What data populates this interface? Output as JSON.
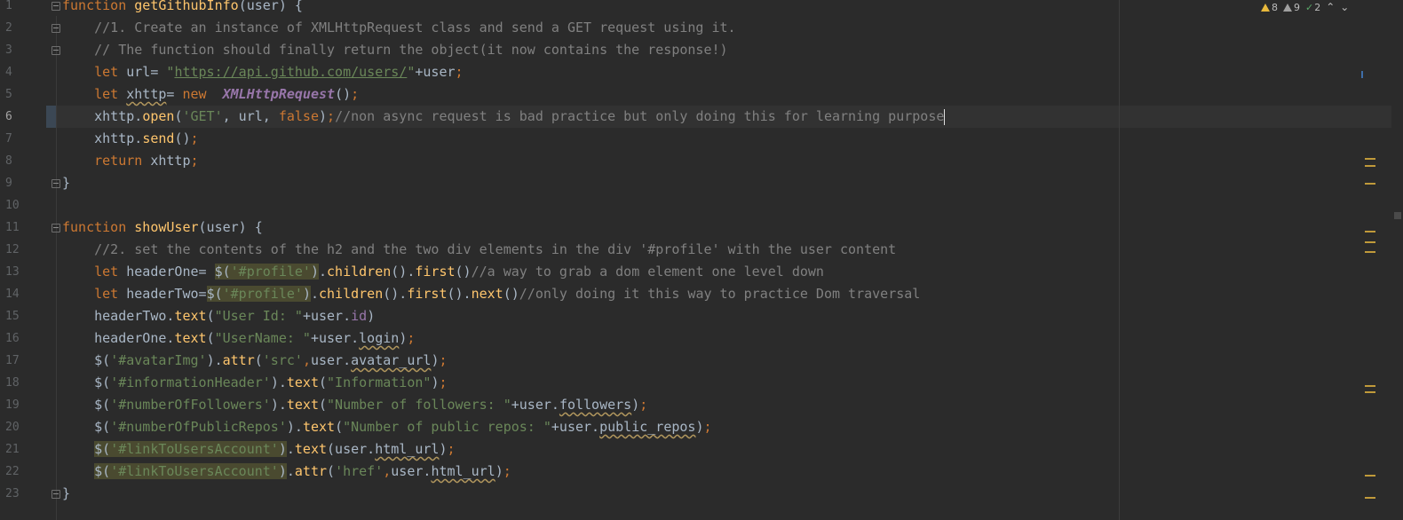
{
  "inspections": {
    "warnings": "8",
    "weak_warnings": "9",
    "typos": "2",
    "up": "⌃",
    "down": "⌄"
  },
  "current_line": "6",
  "lines": [
    {
      "n": "1",
      "text": "function getGithubInfo(user) {"
    },
    {
      "n": "2",
      "text": "    //1. Create an instance of XMLHttpRequest class and send a GET request using it."
    },
    {
      "n": "3",
      "text": "    // The function should finally return the object(it now contains the response!)"
    },
    {
      "n": "4",
      "text": "    let url= \"https://api.github.com/users/\"+user;"
    },
    {
      "n": "5",
      "text": "    let xhttp= new  XMLHttpRequest();"
    },
    {
      "n": "6",
      "text": "    xhttp.open('GET', url, false);//non async request is bad practice but only doing this for learning purpose"
    },
    {
      "n": "7",
      "text": "    xhttp.send();"
    },
    {
      "n": "8",
      "text": "    return xhttp;"
    },
    {
      "n": "9",
      "text": "}"
    },
    {
      "n": "10",
      "text": ""
    },
    {
      "n": "11",
      "text": "function showUser(user) {"
    },
    {
      "n": "12",
      "text": "    //2. set the contents of the h2 and the two div elements in the div '#profile' with the user content"
    },
    {
      "n": "13",
      "text": "    let headerOne= $('#profile').children().first()//a way to grab a dom element one level down"
    },
    {
      "n": "14",
      "text": "    let headerTwo=$('#profile').children().first().next()//only doing it this way to practice Dom traversal"
    },
    {
      "n": "15",
      "text": "    headerTwo.text(\"User Id: \"+user.id)"
    },
    {
      "n": "16",
      "text": "    headerOne.text(\"UserName: \"+user.login);"
    },
    {
      "n": "17",
      "text": "    $('#avatarImg').attr('src',user.avatar_url);"
    },
    {
      "n": "18",
      "text": "    $('#informationHeader').text(\"Information\");"
    },
    {
      "n": "19",
      "text": "    $('#numberOfFollowers').text(\"Number of followers: \"+user.followers);"
    },
    {
      "n": "20",
      "text": "    $('#numberOfPublicRepos').text(\"Number of public repos: \"+user.public_repos);"
    },
    {
      "n": "21",
      "text": "    $('#linkToUsersAccount').text(user.html_url);"
    },
    {
      "n": "22",
      "text": "    $('#linkToUsersAccount').attr('href',user.html_url);"
    },
    {
      "n": "23",
      "text": "}"
    }
  ],
  "tokens": {
    "l1": [
      "function",
      "getGithubInfo",
      "(user) {"
    ],
    "l2": [
      "//1. Create an instance of XMLHttpRequest class and send a GET request using it."
    ],
    "l3": [
      "// The function should finally return the object(it now contains the response!)"
    ],
    "l4": [
      "let",
      " url= ",
      "\"",
      "https://api.github.com/users/",
      "\"",
      "+user",
      ";"
    ],
    "l5": [
      "let",
      " ",
      "xhttp",
      "= ",
      "new",
      "  ",
      "XMLHttpRequest",
      "()",
      ";"
    ],
    "l6": [
      "xhttp.",
      "open",
      "(",
      "'GET'",
      ", url, ",
      "false",
      ")",
      ";",
      "//non async request is bad practice but only doing this for learning purpose"
    ],
    "l7": [
      "xhttp.",
      "send",
      "()",
      ";"
    ],
    "l8": [
      "return",
      " xhttp",
      ";"
    ],
    "l9": [
      "}"
    ],
    "l11": [
      "function",
      "showUser",
      "(user) {"
    ],
    "l12": [
      "//2. set the contents of the h2 and the two div elements in the div '#profile' with the user content"
    ],
    "l13": [
      "let",
      " headerOne= ",
      "$(",
      "'#profile'",
      ")",
      ".",
      "children",
      "().",
      "first",
      "()",
      "//a way to grab a dom element one level down"
    ],
    "l14": [
      "let",
      " headerTwo=",
      "$(",
      "'#profile'",
      ")",
      ".",
      "children",
      "().",
      "first",
      "().",
      "next",
      "()",
      "//only doing it this way to practice Dom traversal"
    ],
    "l15": [
      "headerTwo.",
      "text",
      "(",
      "\"User Id: \"",
      "+user.",
      "id",
      ")"
    ],
    "l16": [
      "headerOne.",
      "text",
      "(",
      "\"UserName: \"",
      "+user.",
      "login",
      ")",
      ";"
    ],
    "l17": [
      "$(",
      "'#avatarImg'",
      ").",
      "attr",
      "(",
      "'src'",
      ",",
      "user.",
      "avatar_url",
      ")",
      ";"
    ],
    "l18": [
      "$(",
      "'#informationHeader'",
      ").",
      "text",
      "(",
      "\"Information\"",
      ")",
      ";"
    ],
    "l19": [
      "$(",
      "'#numberOfFollowers'",
      ").",
      "text",
      "(",
      "\"Number of followers: \"",
      "+user.",
      "followers",
      ")",
      ";"
    ],
    "l20": [
      "$(",
      "'#numberOfPublicRepos'",
      ").",
      "text",
      "(",
      "\"Number of public repos: \"",
      "+user.",
      "public_repos",
      ")",
      ";"
    ],
    "l21": [
      "$(",
      "'#linkToUsersAccount'",
      ")",
      ".",
      "text",
      "(user.",
      "html_url",
      ")",
      ";"
    ],
    "l22": [
      "$(",
      "'#linkToUsersAccount'",
      ")",
      ".",
      "attr",
      "(",
      "'href'",
      ",",
      "user.",
      "html_url",
      ")",
      ";"
    ],
    "l23": [
      "}"
    ]
  },
  "colors": {
    "background": "#2b2b2b",
    "keyword": "#cc7832",
    "function": "#ffc66d",
    "string": "#6a8759",
    "comment": "#808080",
    "class": "#9876aa",
    "text": "#a9b7c6"
  }
}
